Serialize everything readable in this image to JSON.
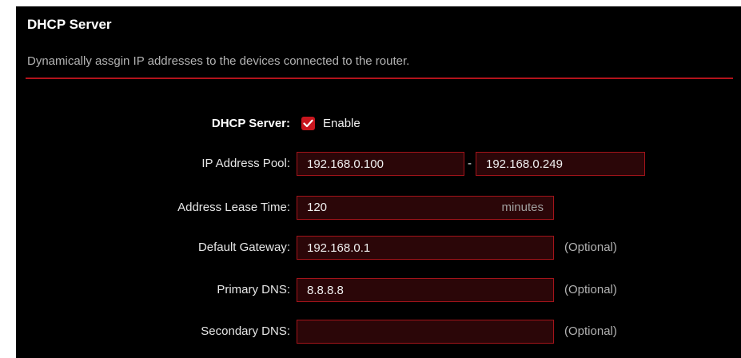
{
  "section": {
    "title": "DHCP Server",
    "description": "Dynamically assgin IP addresses to the devices connected to the router."
  },
  "form": {
    "dhcp_server": {
      "label": "DHCP Server:",
      "checked": true,
      "checkbox_label": "Enable",
      "check_color": "#c8161e"
    },
    "ip_pool": {
      "label": "IP Address Pool:",
      "start": "192.168.0.100",
      "separator": "-",
      "end": "192.168.0.249"
    },
    "lease_time": {
      "label": "Address Lease Time:",
      "value": "120",
      "unit": "minutes"
    },
    "gateway": {
      "label": "Default Gateway:",
      "value": "192.168.0.1",
      "note": "(Optional)"
    },
    "primary_dns": {
      "label": "Primary DNS:",
      "value": "8.8.8.8",
      "note": "(Optional)"
    },
    "secondary_dns": {
      "label": "Secondary DNS:",
      "value": "",
      "note": "(Optional)"
    }
  },
  "colors": {
    "accent": "#b3131b",
    "field_bg": "#2b0608",
    "panel_bg": "#000000"
  },
  "icons": {
    "checkbox": "checkmark-icon"
  }
}
